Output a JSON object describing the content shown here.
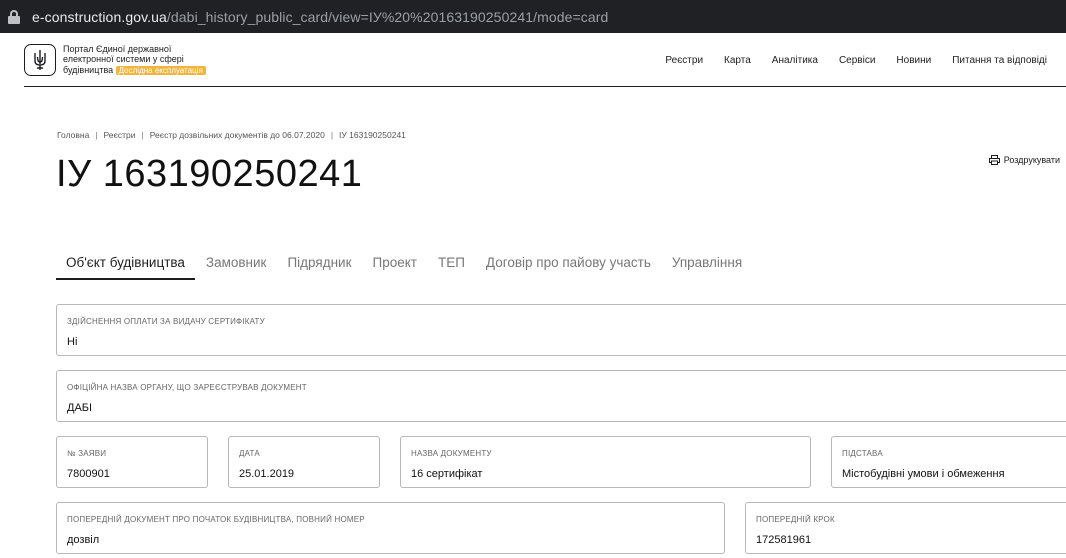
{
  "browser": {
    "url_domain": "e-construction.gov.ua",
    "url_path": "/dabi_history_public_card/view=ІУ%20%20163190250241/mode=card"
  },
  "header": {
    "logo_line1": "Портал Єдиної державної",
    "logo_line2": "електронної системи у сфері",
    "logo_line3": "будівництва",
    "badge": "Дослідна експлуатація",
    "nav": [
      "Реєстри",
      "Карта",
      "Аналітика",
      "Сервіси",
      "Новини",
      "Питання та відповіді"
    ]
  },
  "breadcrumb": [
    "Головна",
    "Реєстри",
    "Реєстр дозвільних документів до 06.07.2020",
    "ІУ 163190250241"
  ],
  "page": {
    "title": "ІУ 163190250241",
    "print_label": "Роздрукувати"
  },
  "tabs": [
    "Об'єкт будівництва",
    "Замовник",
    "Підрядник",
    "Проект",
    "ТЕП",
    "Договір про пайову участь",
    "Управління"
  ],
  "fields": {
    "payment": {
      "label": "Здійснення оплати за видачу сертифікату",
      "value": "Ні"
    },
    "organ": {
      "label": "Офіційна назва органу, що зареєстрував документ",
      "value": "ДАБІ"
    },
    "app_no": {
      "label": "№ заяви",
      "value": "7800901"
    },
    "date": {
      "label": "Дата",
      "value": "25.01.2019"
    },
    "doc_name": {
      "label": "Назва документу",
      "value": "16 сертифікат"
    },
    "basis": {
      "label": "Підстава",
      "value": "Містобудівні умови і обмеження"
    },
    "prev_doc": {
      "label": "Попередній документ про початок будівництва, повний номер",
      "value": "дозвіл"
    },
    "prev_step": {
      "label": "Попередній крок",
      "value": "172581961"
    }
  },
  "colors": {
    "badge": "#f0b43f",
    "urlbar": "#202124",
    "border": "#b8b8b8"
  }
}
